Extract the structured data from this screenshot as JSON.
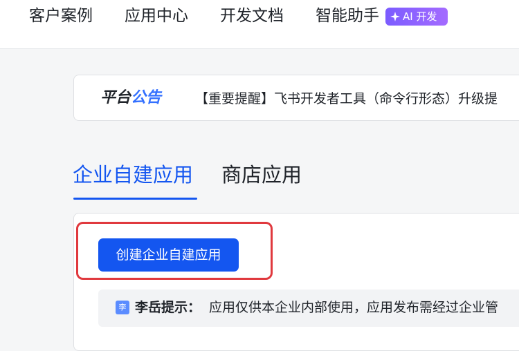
{
  "nav": {
    "items": [
      "客户案例",
      "应用中心",
      "开发文档",
      "智能助手"
    ],
    "ai_badge": "AI 开发"
  },
  "announcement": {
    "title_part1": "平台",
    "title_part2": "公告",
    "text": "【重要提醒】飞书开发者工具（命令行形态）升级提"
  },
  "tabs": [
    {
      "label": "企业自建应用",
      "active": true
    },
    {
      "label": "商店应用",
      "active": false
    }
  ],
  "create_button": "创建企业自建应用",
  "tip": {
    "avatar": "李",
    "name": "李岳提示：",
    "text": "应用仅供本企业内部使用，应用发布需经过企业管"
  },
  "colors": {
    "accent": "#1456f0",
    "highlight": "#e0393e",
    "ai_badge": "#8a63ff"
  }
}
